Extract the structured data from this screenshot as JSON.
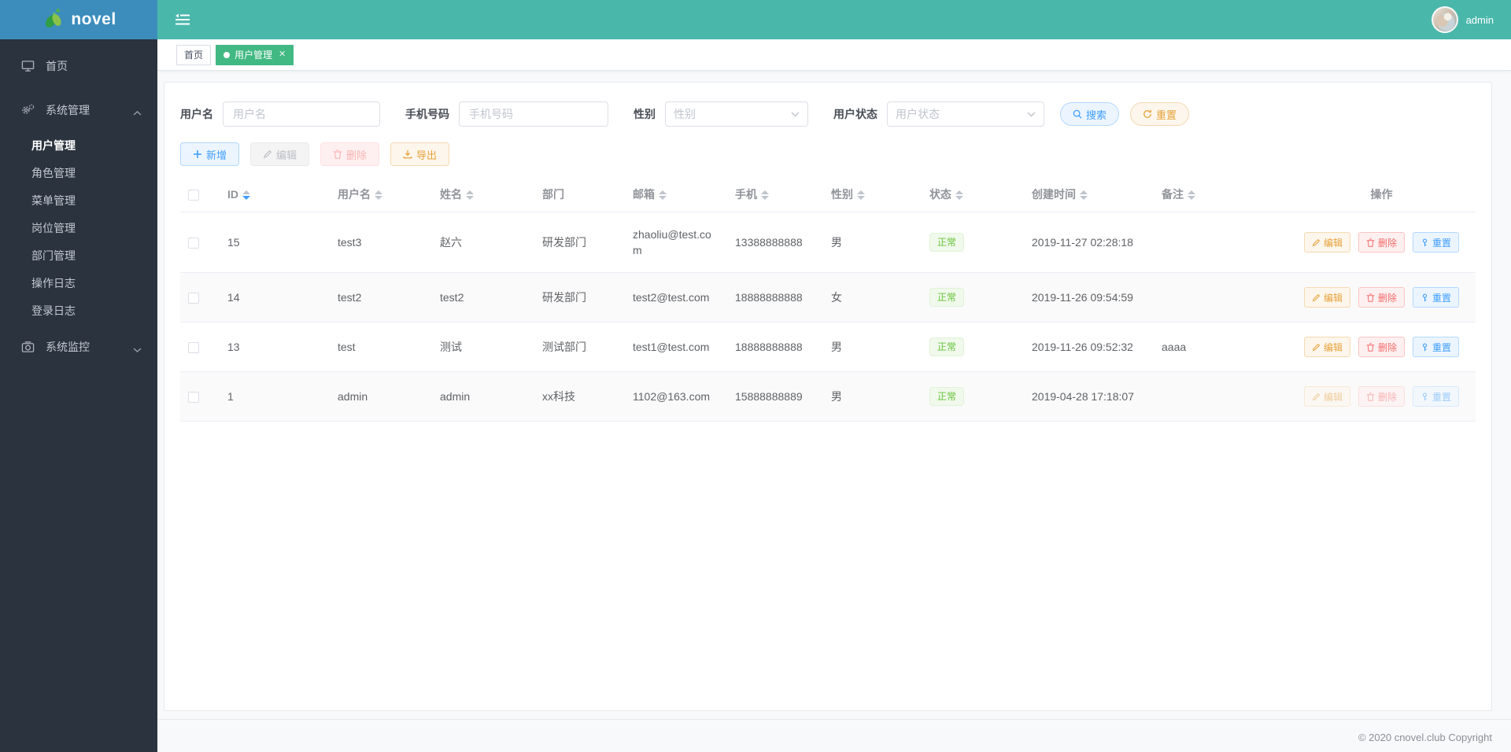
{
  "brand": {
    "name": "novel"
  },
  "header": {
    "username": "admin"
  },
  "sidebar": {
    "home": {
      "label": "首页",
      "icon": "monitor-icon"
    },
    "system": {
      "label": "系统管理",
      "icon": "gears-icon",
      "expanded": true,
      "children": [
        "用户管理",
        "角色管理",
        "菜单管理",
        "岗位管理",
        "部门管理",
        "操作日志",
        "登录日志"
      ],
      "active_child": "用户管理"
    },
    "monitor": {
      "label": "系统监控",
      "icon": "camera-icon",
      "expanded": false
    }
  },
  "tabs": [
    {
      "label": "首页",
      "active": false
    },
    {
      "label": "用户管理",
      "active": true,
      "closable": true
    }
  ],
  "filters": {
    "username_label": "用户名",
    "username_placeholder": "用户名",
    "username_value": "",
    "phone_label": "手机号码",
    "phone_placeholder": "手机号码",
    "phone_value": "",
    "gender_label": "性别",
    "gender_placeholder": "性别",
    "gender_value": "",
    "status_label": "用户状态",
    "status_placeholder": "用户状态",
    "status_value": "",
    "search_label": "搜索",
    "reset_label": "重置"
  },
  "toolbar": {
    "add_label": "新增",
    "edit_label": "编辑",
    "delete_label": "删除",
    "export_label": "导出",
    "edit_disabled": true,
    "delete_disabled": true
  },
  "table": {
    "columns": [
      {
        "label": "ID",
        "sortable": true,
        "sort": "desc"
      },
      {
        "label": "用户名",
        "sortable": true,
        "sort": null
      },
      {
        "label": "姓名",
        "sortable": true,
        "sort": null
      },
      {
        "label": "部门",
        "sortable": false,
        "sort": null
      },
      {
        "label": "邮箱",
        "sortable": true,
        "sort": null
      },
      {
        "label": "手机",
        "sortable": true,
        "sort": null
      },
      {
        "label": "性别",
        "sortable": true,
        "sort": null
      },
      {
        "label": "状态",
        "sortable": true,
        "sort": null
      },
      {
        "label": "创建时间",
        "sortable": true,
        "sort": null
      },
      {
        "label": "备注",
        "sortable": true,
        "sort": null
      },
      {
        "label": "操作",
        "sortable": false,
        "sort": null
      }
    ],
    "rows": [
      {
        "id": "15",
        "username": "test3",
        "name": "赵六",
        "dept": "研发部门",
        "email": "zhaoliu@test.com",
        "phone": "13388888888",
        "gender": "男",
        "status": "正常",
        "created_at": "2019-11-27 02:28:18",
        "remark": "",
        "actions_disabled": false
      },
      {
        "id": "14",
        "username": "test2",
        "name": "test2",
        "dept": "研发部门",
        "email": "test2@test.com",
        "phone": "18888888888",
        "gender": "女",
        "status": "正常",
        "created_at": "2019-11-26 09:54:59",
        "remark": "",
        "actions_disabled": false
      },
      {
        "id": "13",
        "username": "test",
        "name": "测试",
        "dept": "测试部门",
        "email": "test1@test.com",
        "phone": "18888888888",
        "gender": "男",
        "status": "正常",
        "created_at": "2019-11-26 09:52:32",
        "remark": "aaaa",
        "actions_disabled": false
      },
      {
        "id": "1",
        "username": "admin",
        "name": "admin",
        "dept": "xx科技",
        "email": "1102@163.com",
        "phone": "15888888889",
        "gender": "男",
        "status": "正常",
        "created_at": "2019-04-28 17:18:07",
        "remark": "",
        "actions_disabled": true
      }
    ],
    "row_actions": {
      "edit": "编辑",
      "delete": "删除",
      "reset": "重置"
    }
  },
  "footer": {
    "copyright": "© 2020 cnovel.club Copyright"
  },
  "colors": {
    "header_bg": "#4ab7ab",
    "logo_bg": "#3c8dbc",
    "sidebar_bg": "#2a333e",
    "active_tab": "#42b983",
    "primary": "#409eff",
    "warning": "#e6a23c",
    "danger": "#f56c6c",
    "success": "#67c23a"
  }
}
